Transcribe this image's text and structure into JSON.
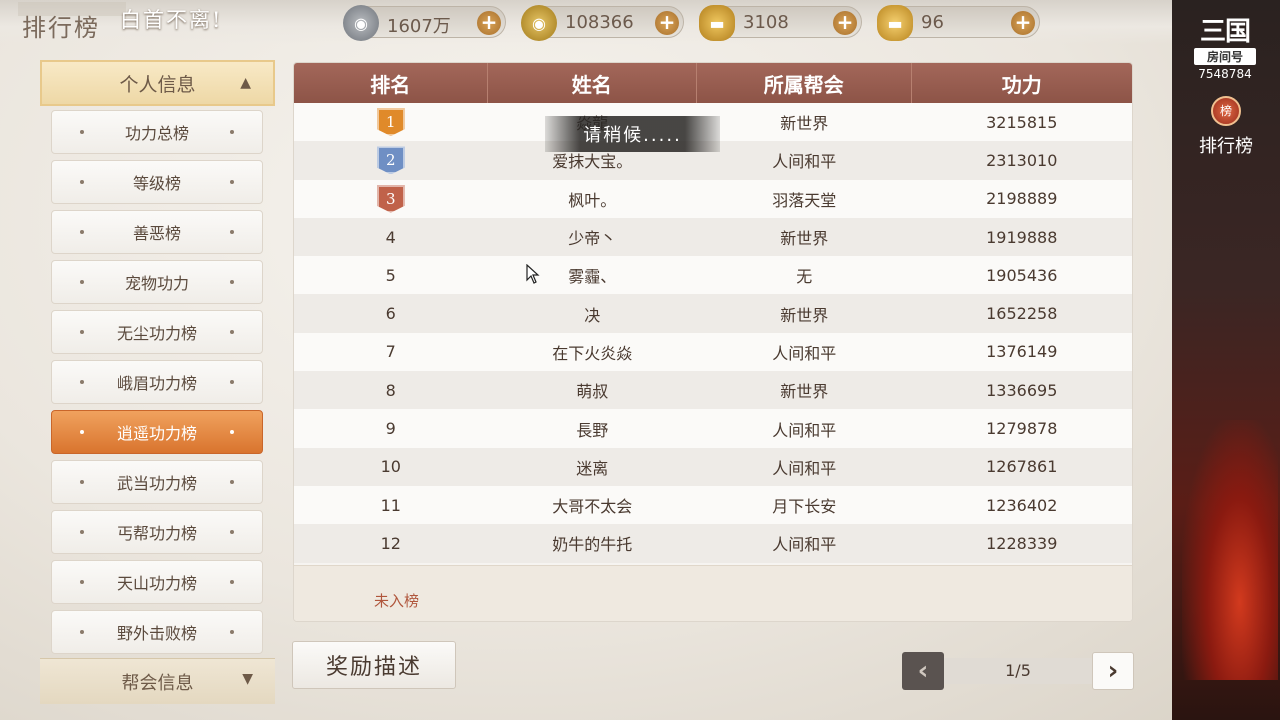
{
  "header": {
    "title": "排行榜",
    "marquee": "白首不离!"
  },
  "resources": [
    {
      "name": "silver",
      "value": "1607万",
      "icon": "silver-coin-icon",
      "color": "#8a8f96"
    },
    {
      "name": "gold",
      "value": "108366",
      "icon": "gold-coin-icon",
      "color": "#c9a03a"
    },
    {
      "name": "ingot-bound",
      "value": "3108",
      "icon": "ingot-icon",
      "color": "#d8a838"
    },
    {
      "name": "ingot",
      "value": "96",
      "icon": "gold-ingot-icon",
      "color": "#e2b23c"
    }
  ],
  "room": {
    "logo": "三国",
    "label": "房间号",
    "number": "7548784"
  },
  "rank_button": {
    "medal": "榜",
    "label": "排行榜"
  },
  "sidebar": {
    "header": "个人信息",
    "items": [
      {
        "label": "功力总榜"
      },
      {
        "label": "等级榜"
      },
      {
        "label": "善恶榜"
      },
      {
        "label": "宠物功力"
      },
      {
        "label": "无尘功力榜"
      },
      {
        "label": "峨眉功力榜"
      },
      {
        "label": "逍遥功力榜"
      },
      {
        "label": "武当功力榜"
      },
      {
        "label": "丐帮功力榜"
      },
      {
        "label": "天山功力榜"
      },
      {
        "label": "野外击败榜"
      }
    ],
    "active_index": 6,
    "footer": "帮会信息"
  },
  "table": {
    "headers": [
      "排名",
      "姓名",
      "所属帮会",
      "功力"
    ],
    "medal_colors": [
      "#e08a2a",
      "#6f8fc4",
      "#c0624a"
    ],
    "rows": [
      {
        "rank": "1",
        "name": "焱龍",
        "guild": "新世界",
        "power": "3215815"
      },
      {
        "rank": "2",
        "name": "爱抹大宝。",
        "guild": "人间和平",
        "power": "2313010"
      },
      {
        "rank": "3",
        "name": "枫叶。",
        "guild": "羽落天堂",
        "power": "2198889"
      },
      {
        "rank": "4",
        "name": "少帝丶",
        "guild": "新世界",
        "power": "1919888"
      },
      {
        "rank": "5",
        "name": "雾霾、",
        "guild": "无",
        "power": "1905436"
      },
      {
        "rank": "6",
        "name": "决",
        "guild": "新世界",
        "power": "1652258"
      },
      {
        "rank": "7",
        "name": "在下火炎焱",
        "guild": "人间和平",
        "power": "1376149"
      },
      {
        "rank": "8",
        "name": "萌叔",
        "guild": "新世界",
        "power": "1336695"
      },
      {
        "rank": "9",
        "name": "長野",
        "guild": "人间和平",
        "power": "1279878"
      },
      {
        "rank": "10",
        "name": "迷离",
        "guild": "人间和平",
        "power": "1267861"
      },
      {
        "rank": "11",
        "name": "大哥不太会",
        "guild": "月下长安",
        "power": "1236402"
      },
      {
        "rank": "12",
        "name": "奶牛的牛托",
        "guild": "人间和平",
        "power": "1228339"
      }
    ],
    "unranked": "未入榜"
  },
  "toast": "请稍候.....",
  "reward_button": "奖励描述",
  "pager": {
    "label": "1/5",
    "prev": "‹",
    "next": "›"
  }
}
